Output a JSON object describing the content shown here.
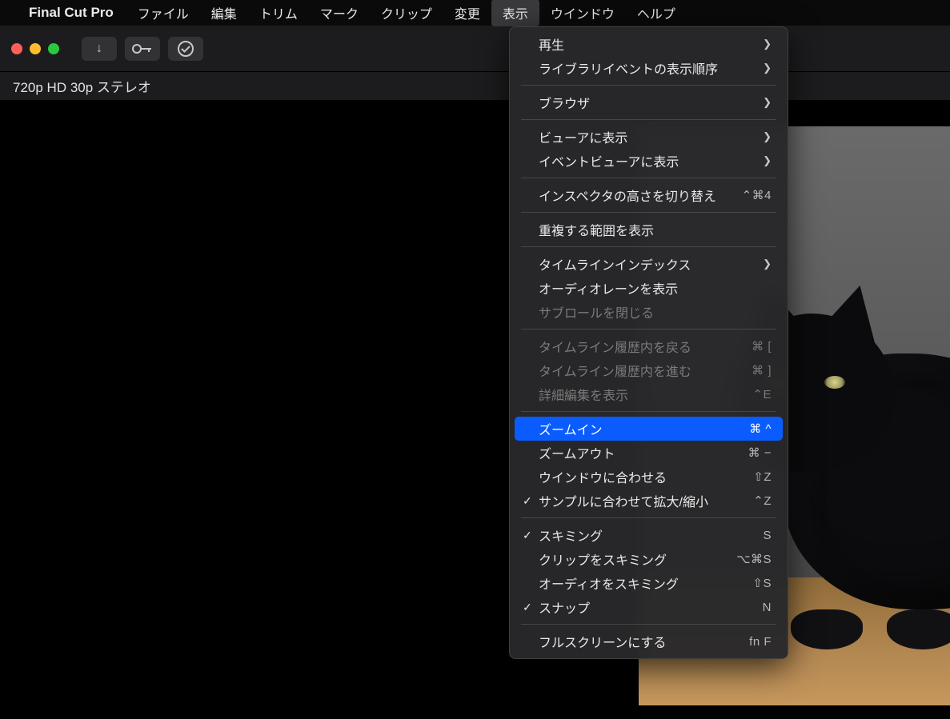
{
  "menubar": {
    "apple_glyph": "",
    "app_name": "Final Cut Pro",
    "items": [
      "ファイル",
      "編集",
      "トリム",
      "マーク",
      "クリップ",
      "変更",
      "表示",
      "ウインドウ",
      "ヘルプ"
    ],
    "active_index": 6
  },
  "toolbar": {
    "icons": {
      "import": "↓",
      "keyword": "⌘",
      "check": "✓"
    }
  },
  "info_strip": {
    "text": "720p HD 30p ステレオ"
  },
  "dropdown": {
    "open_for": "表示",
    "highlighted_index": 14,
    "items_flat": [
      {
        "type": "item",
        "label": "再生",
        "submenu": true
      },
      {
        "type": "item",
        "label": "ライブラリイベントの表示順序",
        "submenu": true
      },
      {
        "type": "sep"
      },
      {
        "type": "item",
        "label": "ブラウザ",
        "submenu": true
      },
      {
        "type": "sep"
      },
      {
        "type": "item",
        "label": "ビューアに表示",
        "submenu": true
      },
      {
        "type": "item",
        "label": "イベントビューアに表示",
        "submenu": true
      },
      {
        "type": "sep"
      },
      {
        "type": "item",
        "label": "インスペクタの高さを切り替え",
        "shortcut": "⌃⌘4"
      },
      {
        "type": "sep"
      },
      {
        "type": "item",
        "label": "重複する範囲を表示"
      },
      {
        "type": "sep"
      },
      {
        "type": "item",
        "label": "タイムラインインデックス",
        "submenu": true
      },
      {
        "type": "item",
        "label": "オーディオレーンを表示"
      },
      {
        "type": "item",
        "label": "サブロールを閉じる",
        "disabled": true
      },
      {
        "type": "sep"
      },
      {
        "type": "item",
        "label": "タイムライン履歴内を戻る",
        "shortcut": "⌘ [",
        "disabled": true
      },
      {
        "type": "item",
        "label": "タイムライン履歴内を進む",
        "shortcut": "⌘ ]",
        "disabled": true
      },
      {
        "type": "item",
        "label": "詳細編集を表示",
        "shortcut": "⌃E",
        "disabled": true
      },
      {
        "type": "sep"
      },
      {
        "type": "item",
        "label": "ズームイン",
        "shortcut": "⌘ ^",
        "highlight": true
      },
      {
        "type": "item",
        "label": "ズームアウト",
        "shortcut": "⌘ −"
      },
      {
        "type": "item",
        "label": "ウインドウに合わせる",
        "shortcut": "⇧Z"
      },
      {
        "type": "item",
        "label": "サンプルに合わせて拡大/縮小",
        "shortcut": "⌃Z",
        "checked": true
      },
      {
        "type": "sep"
      },
      {
        "type": "item",
        "label": "スキミング",
        "shortcut": "S",
        "checked": true
      },
      {
        "type": "item",
        "label": "クリップをスキミング",
        "shortcut": "⌥⌘S"
      },
      {
        "type": "item",
        "label": "オーディオをスキミング",
        "shortcut": "⇧S"
      },
      {
        "type": "item",
        "label": "スナップ",
        "shortcut": "N",
        "checked": true
      },
      {
        "type": "sep"
      },
      {
        "type": "item",
        "label": "フルスクリーンにする",
        "shortcut": "fn F"
      }
    ]
  },
  "viewer": {
    "subject": "black-cat-on-wooden-floor"
  }
}
